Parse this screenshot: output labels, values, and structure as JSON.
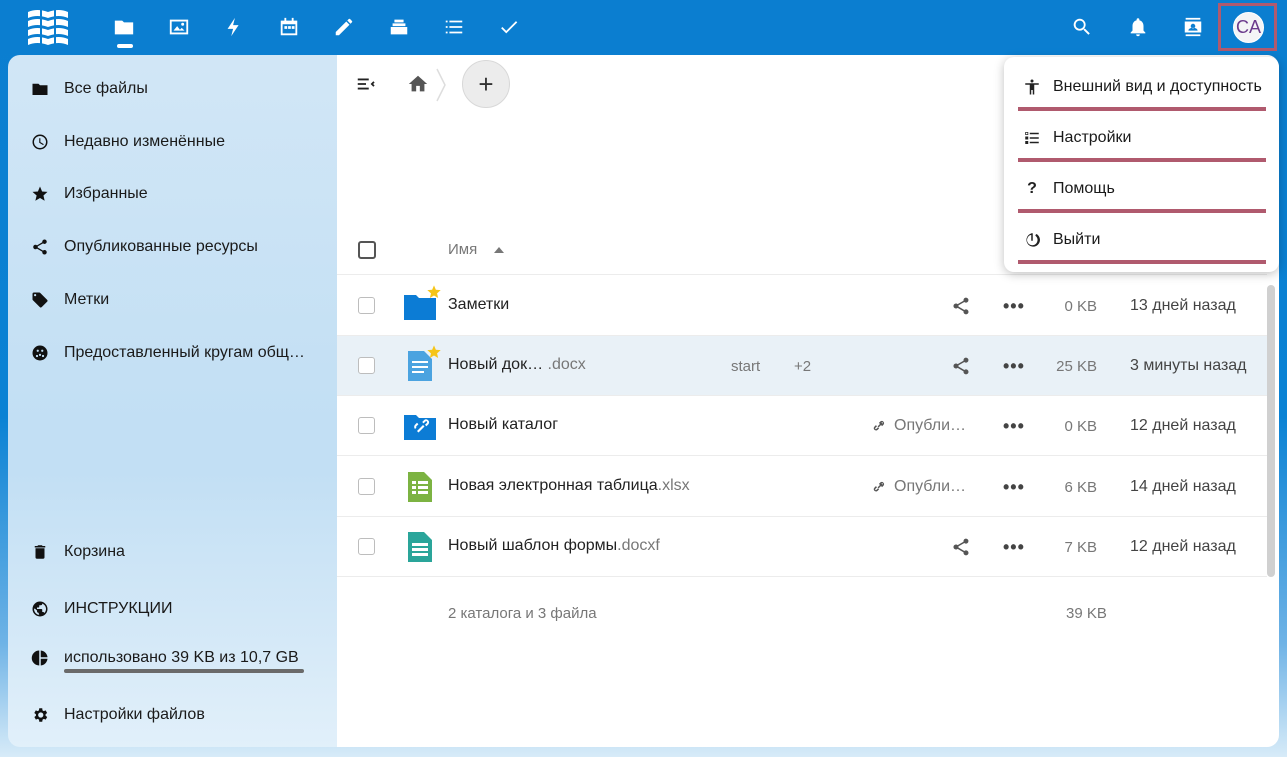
{
  "header": {
    "avatar_initials": "CA",
    "apps": [
      {
        "name": "files-icon"
      },
      {
        "name": "photos-icon"
      },
      {
        "name": "activity-icon"
      },
      {
        "name": "calendar-icon"
      },
      {
        "name": "notes-icon"
      },
      {
        "name": "deck-icon"
      },
      {
        "name": "tasks-icon"
      },
      {
        "name": "checkmark-icon"
      }
    ]
  },
  "sidebar": {
    "items": [
      {
        "label": "Все файлы",
        "icon": "folder-icon"
      },
      {
        "label": "Недавно изменённые",
        "icon": "clock-icon"
      },
      {
        "label": "Избранные",
        "icon": "star-icon"
      },
      {
        "label": "Опубликованные ресурсы",
        "icon": "share-icon"
      },
      {
        "label": "Метки",
        "icon": "tag-icon"
      },
      {
        "label": "Предоставленный кругам общ…",
        "icon": "circles-icon"
      }
    ],
    "bottom": {
      "trash": "Корзина",
      "instructions": "ИНСТРУКЦИИ",
      "quota": "использовано 39 KB из 10,7 GB",
      "settings": "Настройки файлов"
    },
    "quota_fraction": 1e-05
  },
  "files": {
    "column_name": "Имя",
    "rows": [
      {
        "name": "Заметки",
        "ext": "",
        "size": "0 KB",
        "date": "13 дней назад",
        "type": "folder",
        "favorite": true
      },
      {
        "name": "Новый док… ",
        "ext": ".docx",
        "size": "25 KB",
        "date": "3 минуты назад",
        "type": "document",
        "favorite": true,
        "tag": "start",
        "tag_more": "+2"
      },
      {
        "name": "Новый каталог",
        "ext": "",
        "size": "0 KB",
        "date": "12 дней назад",
        "type": "linked-folder",
        "favorite": false,
        "link_share": "Опубли…"
      },
      {
        "name": "Новая электронная таблица",
        "ext": ".xlsx",
        "size": "6 KB",
        "date": "14 дней назад",
        "type": "spreadsheet",
        "favorite": false,
        "link_share": "Опубли…"
      },
      {
        "name": "Новый шаблон формы",
        "ext": ".docxf",
        "size": "7 KB",
        "date": "12 дней назад",
        "type": "form",
        "favorite": false
      }
    ],
    "summary": "2 каталога и 3 файла",
    "summary_size": "39 KB"
  },
  "menu": {
    "items": [
      {
        "label": "Внешний вид и доступность",
        "icon": "accessibility-icon"
      },
      {
        "label": "Настройки",
        "icon": "settings-list-icon"
      },
      {
        "label": "Помощь",
        "icon": "help-icon"
      },
      {
        "label": "Выйти",
        "icon": "power-icon"
      }
    ]
  }
}
